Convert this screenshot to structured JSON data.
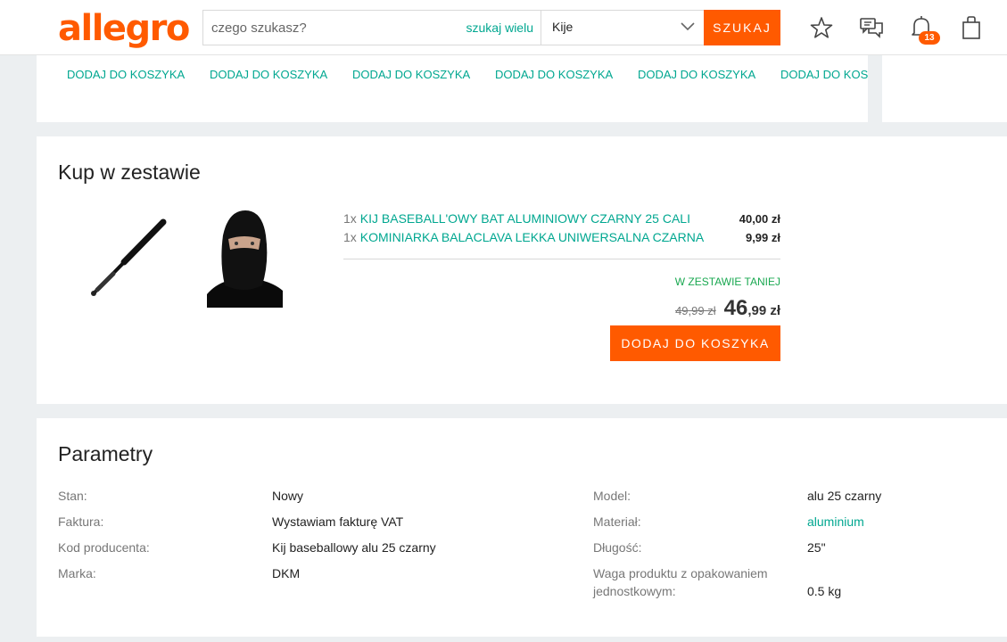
{
  "header": {
    "logo": "allegro",
    "search_placeholder": "czego szukasz?",
    "search_multi": "szukaj wielu",
    "category": "Kije",
    "search_button": "SZUKAJ",
    "notifications_count": "13"
  },
  "strip": {
    "links": [
      "DODAJ DO KOSZYKA",
      "DODAJ DO KOSZYKA",
      "DODAJ DO KOSZYKA",
      "DODAJ DO KOSZYKA",
      "DODAJ DO KOSZYKA",
      "DODAJ DO KOSZYKA"
    ]
  },
  "set": {
    "title": "Kup w zestawie",
    "items": [
      {
        "qty": "1x",
        "name": "KIJ BASEBALL'OWY BAT ALUMINIOWY CZARNY 25 CALI",
        "price": "40,00 zł"
      },
      {
        "qty": "1x",
        "name": "KOMINIARKA BALACLAVA LEKKA UNIWERSALNA CZARNA",
        "price": "9,99 zł"
      }
    ],
    "cheaper_label": "W ZESTAWIE TANIEJ",
    "old_price": "49,99 zł",
    "new_price_int": "46",
    "new_price_rest": ",99 zł",
    "add_button": "DODAJ DO KOSZYKA"
  },
  "params": {
    "title": "Parametry",
    "left": [
      {
        "key": "Stan:",
        "value": "Nowy"
      },
      {
        "key": "Faktura:",
        "value": "Wystawiam fakturę VAT"
      },
      {
        "key": "Kod producenta:",
        "value": "Kij baseballowy alu 25 czarny"
      },
      {
        "key": "Marka:",
        "value": "DKM"
      }
    ],
    "right": [
      {
        "key": "Model:",
        "value": "alu 25 czarny"
      },
      {
        "key": "Materiał:",
        "value": "aluminium"
      },
      {
        "key": "Długość:",
        "value": "25\""
      },
      {
        "key": "Waga produktu z opakowaniem jednostkowym:",
        "value": "0.5 kg"
      }
    ]
  }
}
